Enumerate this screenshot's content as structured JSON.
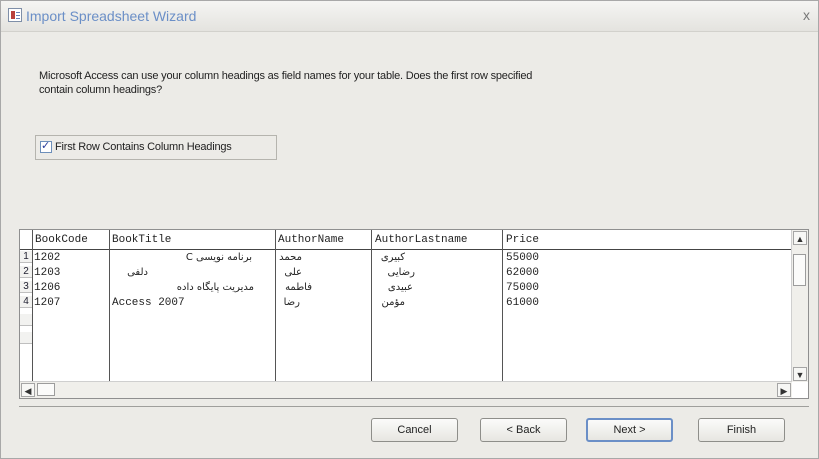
{
  "window": {
    "title": "Import Spreadsheet Wizard",
    "close_glyph": "x"
  },
  "prompt": "Microsoft Access can use your column headings as field names for your table. Does the first row specified contain column headings?",
  "first_row_checkbox": {
    "label": "First Row Contains Column Headings",
    "checked": true,
    "check_glyph": "✓"
  },
  "grid": {
    "columns": [
      "BookCode",
      "BookTitle",
      "AuthorName",
      "AuthorLastname",
      "Price"
    ],
    "row_numbers": [
      "1",
      "2",
      "3",
      "4",
      "",
      ""
    ],
    "rows": [
      [
        "1202",
        "C برنامه نویسی",
        "محمد",
        "کبیری",
        "55000"
      ],
      [
        "1203",
        "دلفی",
        "علی",
        "رضایی",
        "62000"
      ],
      [
        "1206",
        "مدیریت پایگاه داده",
        "فاطمه",
        "عبیدی",
        "75000"
      ],
      [
        "1207",
        "Access 2007",
        "رضا",
        "مؤمن",
        "61000"
      ]
    ],
    "scroll_up_glyph": "▲",
    "scroll_down_glyph": "▼",
    "scroll_left_glyph": "◀",
    "scroll_right_glyph": "▶"
  },
  "buttons": {
    "cancel": "Cancel",
    "back": "< Back",
    "next": "Next >",
    "finish": "Finish"
  },
  "colors": {
    "title_text": "#6b8fc7",
    "default_button_border": "#6b8fc7",
    "dialog_background": "#ecebe7"
  }
}
